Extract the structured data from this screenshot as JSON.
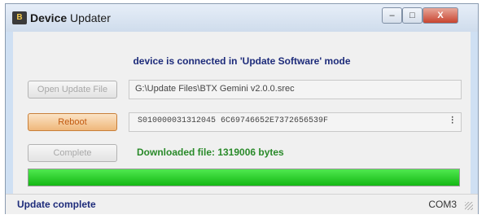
{
  "window": {
    "title_app": "Device",
    "title_rest": "Updater",
    "icon_glyph": "B"
  },
  "controls": {
    "minimize": "–",
    "maximize": "□",
    "close": "X"
  },
  "connection_message": "device is connected in 'Update Software' mode",
  "open_button_label": "Open Update File",
  "file_path": "G:\\Update Files\\BTX Gemini v2.0.0.srec",
  "reboot_button_label": "Reboot",
  "srec_line": "S010000031312045 6C69746652E7372656539F",
  "spinner_glyph": "⁝",
  "complete_button_label": "Complete",
  "download_status": "Downloaded file: 1319006 bytes",
  "progress_fraction": 1.0,
  "status_bar": {
    "left": "Update complete",
    "right": "COM3"
  },
  "colors": {
    "accent_text": "#1d2b7a",
    "success_text": "#2a8a2a",
    "progress_fill": "#14b814",
    "reboot_button": "#efb77a"
  }
}
